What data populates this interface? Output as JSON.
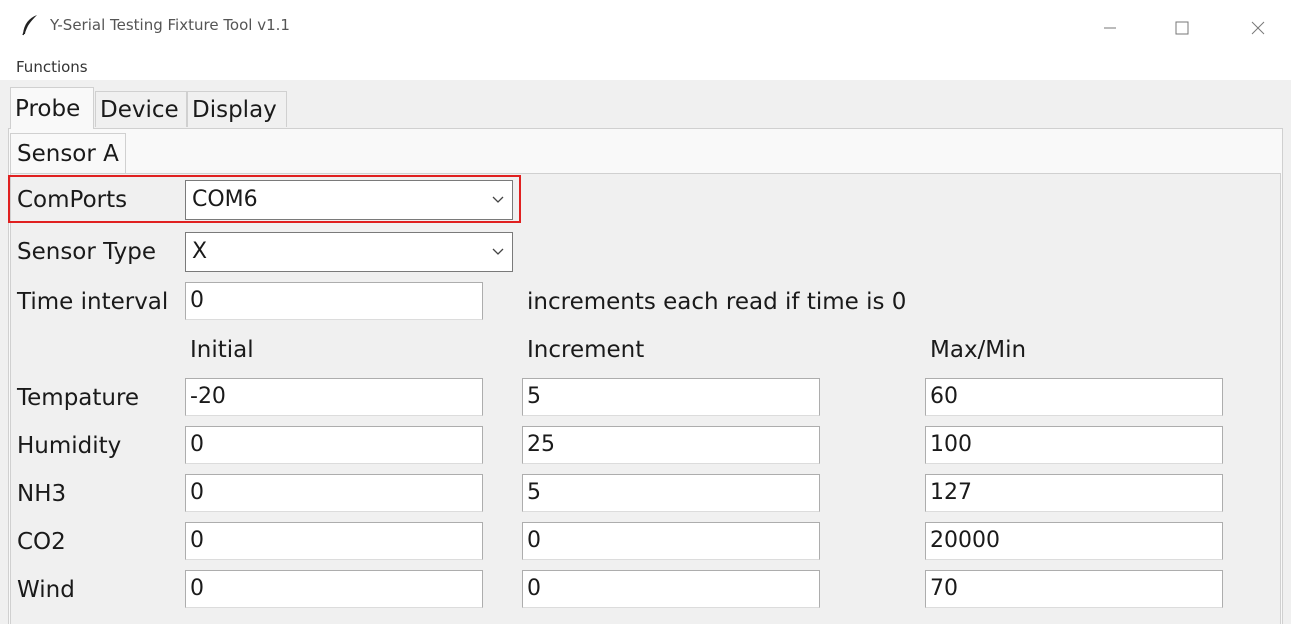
{
  "window": {
    "title": "Y-Serial Testing Fixture Tool  v1.1",
    "icon": "feather-icon",
    "controls": [
      "minimize-icon",
      "maximize-icon",
      "close-icon"
    ]
  },
  "menu": {
    "functions": "Functions"
  },
  "tabs": [
    {
      "label": "Probe",
      "selected": true
    },
    {
      "label": "Device",
      "selected": false
    },
    {
      "label": "Display",
      "selected": false
    }
  ],
  "subtab": {
    "label": "Sensor A"
  },
  "comports": {
    "label": "ComPorts",
    "value": "COM6"
  },
  "sensor_type": {
    "label": "Sensor Type",
    "value": "X"
  },
  "time_interval": {
    "label": "Time interval",
    "value": "0",
    "note": "increments each read if time is 0"
  },
  "columns": {
    "initial": "Initial",
    "increment": "Increment",
    "maxmin": "Max/Min"
  },
  "rows": [
    {
      "label": "Tempature",
      "initial": "-20",
      "increment": "5",
      "maxmin": "60"
    },
    {
      "label": "Humidity",
      "initial": "0",
      "increment": "25",
      "maxmin": "100"
    },
    {
      "label": "NH3",
      "initial": "0",
      "increment": "5",
      "maxmin": "127"
    },
    {
      "label": "CO2",
      "initial": "0",
      "increment": "0",
      "maxmin": "20000"
    },
    {
      "label": "Wind",
      "initial": "0",
      "increment": "0",
      "maxmin": "70"
    }
  ],
  "colors": {
    "highlight": "#e02020",
    "background": "#f0f0f0"
  }
}
